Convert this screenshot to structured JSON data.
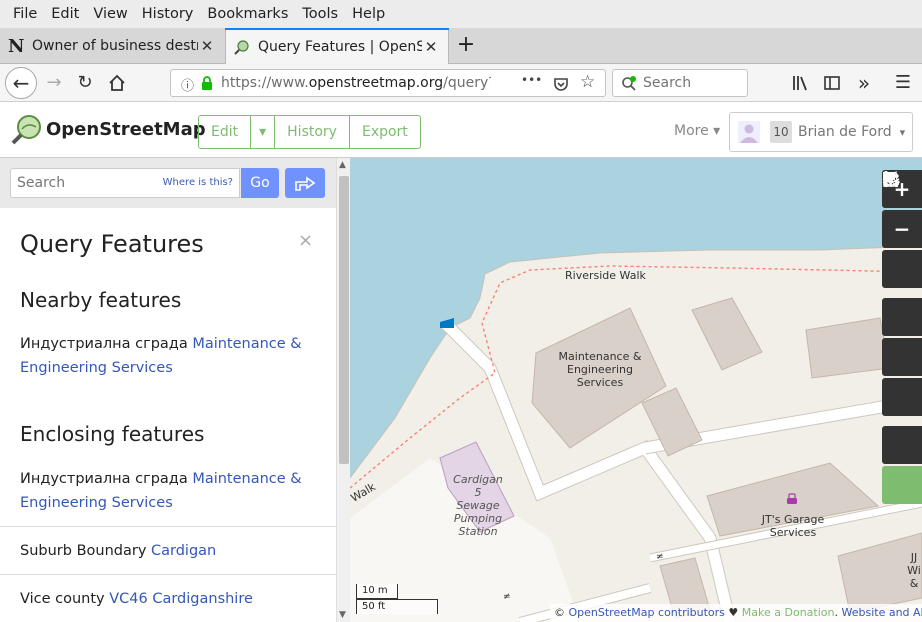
{
  "menubar": {
    "items": [
      "File",
      "Edit",
      "View",
      "History",
      "Bookmarks",
      "Tools",
      "Help"
    ]
  },
  "tabs": [
    {
      "title": "Owner of business destro",
      "icon": "N"
    },
    {
      "title": "Query Features | OpenStr",
      "icon": "osm-icon"
    }
  ],
  "navbar": {
    "url_prefix": "https://www.",
    "url_domain": "openstreetmap.org",
    "url_path": "/query?la",
    "search_placeholder": "Search",
    "more_dots": "•••"
  },
  "header": {
    "brand": "OpenStreetMap",
    "buttons": [
      "Edit",
      "History",
      "Export"
    ],
    "more": "More",
    "user_count": "10",
    "user_name": "Brian de Ford"
  },
  "sidebar": {
    "search_placeholder": "Search",
    "where_is": "Where is this?",
    "go": "Go",
    "title": "Query Features",
    "close": "×",
    "nearby_heading": "Nearby features",
    "nearby": [
      {
        "type": "Индустриална сграда",
        "name": "Maintenance & Engineering Services"
      }
    ],
    "enclosing_heading": "Enclosing features",
    "enclosing": [
      {
        "type": "Индустриална сграда",
        "name": "Maintenance & Engineering Services"
      },
      {
        "type": "Suburb Boundary",
        "name": "Cardigan"
      },
      {
        "type": "Vice county",
        "name": "VC46 Cardiganshire"
      }
    ]
  },
  "map": {
    "labels": {
      "riverside": "Riverside Walk",
      "walk": "Walk",
      "maintenance": "Maintenance & Engineering Services",
      "pumping": "Cardigan 5 Sewage Pumping Station",
      "garage": "JT's Garage Services",
      "edge": "JJ Wi &"
    },
    "scale_m": "10 m",
    "scale_ft": "50 ft",
    "attribution": {
      "copyright": "©",
      "contributors": "OpenStreetMap contributors",
      "heart": "♥",
      "donation": "Make a Donation",
      "dot": ".",
      "terms": "Website and API terms"
    },
    "colors": {
      "water": "#aad3df",
      "land": "#f2efe9",
      "building": "#d9d0c9",
      "road": "#ffffff",
      "path": "#fa8072",
      "pumping": "#e3d5e6",
      "accent": "#7ebc6f",
      "link": "#3457b8"
    }
  }
}
